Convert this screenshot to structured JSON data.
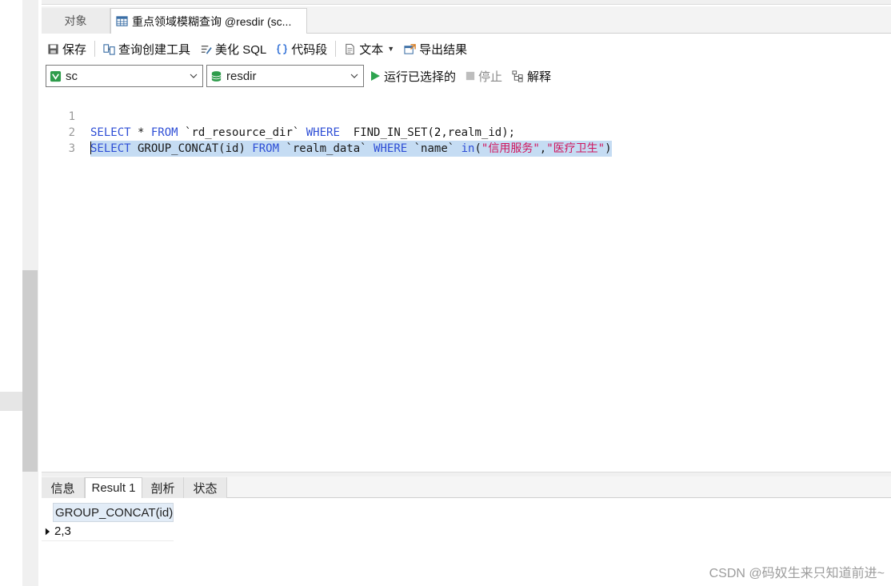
{
  "tabs": {
    "objects": "对象",
    "query": "重点领域模糊查询 @resdir (sc..."
  },
  "toolbar": {
    "save": "保存",
    "query_builder": "查询创建工具",
    "beautify_sql": "美化 SQL",
    "code_snippet": "代码段",
    "text": "文本",
    "export_result": "导出结果"
  },
  "selectors": {
    "connection": "sc",
    "database": "resdir",
    "run_selected": "运行已选择的",
    "stop": "停止",
    "explain": "解释"
  },
  "editor": {
    "line_numbers": [
      "1",
      "2",
      "3"
    ],
    "line1": {
      "p1": "SELECT",
      "p2": " * ",
      "p3": "FROM",
      "p4": " `rd_resource_dir` ",
      "p5": "WHERE",
      "p6": "  FIND_IN_SET(",
      "p7": "2",
      "p8": ",realm_id);"
    },
    "line2": {
      "p1": "SELECT",
      "p2": " GROUP_CONCAT(id) ",
      "p3": "FROM",
      "p4": " `realm_data` ",
      "p5": "WHERE",
      "p6": " `name` ",
      "p7": "in",
      "p8": "(",
      "p9": "\"信用服务\"",
      "p10": ",",
      "p11": "\"医疗卫生\"",
      "p12": ")"
    }
  },
  "result_tabs": {
    "info": "信息",
    "result1": "Result 1",
    "profile": "剖析",
    "status": "状态"
  },
  "grid": {
    "column": "GROUP_CONCAT(id)",
    "value": "2,3"
  },
  "watermark": "CSDN @码奴生来只知道前进~"
}
